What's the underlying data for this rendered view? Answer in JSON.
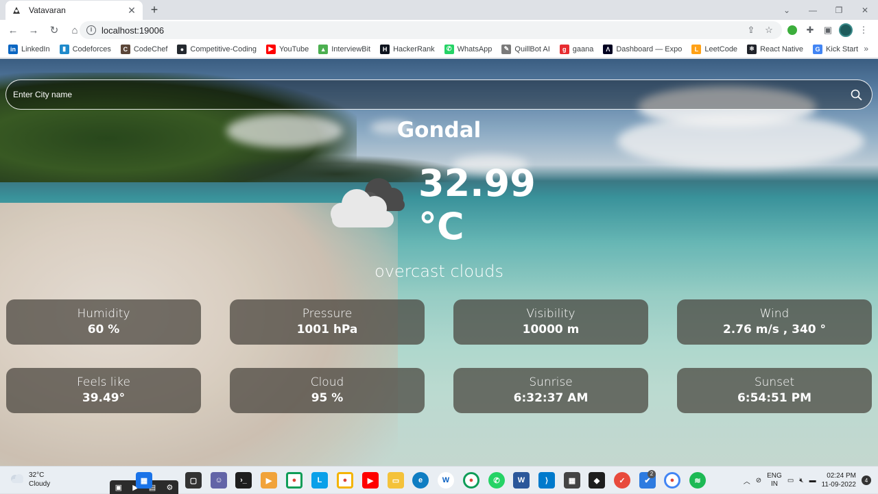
{
  "browser": {
    "tab_title": "Vatavaran",
    "url": "localhost:19006",
    "bookmarks": [
      {
        "label": "LinkedIn",
        "color": "#0a66c2",
        "glyph": "in"
      },
      {
        "label": "Codeforces",
        "color": "#1f8acb",
        "glyph": "▮"
      },
      {
        "label": "CodeChef",
        "color": "#5b4638",
        "glyph": "C"
      },
      {
        "label": "Competitive-Coding",
        "color": "#24292f",
        "glyph": "●"
      },
      {
        "label": "YouTube",
        "color": "#ff0000",
        "glyph": "▶"
      },
      {
        "label": "InterviewBit",
        "color": "#4caf50",
        "glyph": "▲"
      },
      {
        "label": "HackerRank",
        "color": "#0e141e",
        "glyph": "H"
      },
      {
        "label": "WhatsApp",
        "color": "#25d366",
        "glyph": "✆"
      },
      {
        "label": "QuillBot AI",
        "color": "#7a7a7a",
        "glyph": "✎"
      },
      {
        "label": "gaana",
        "color": "#e72c30",
        "glyph": "g"
      },
      {
        "label": "Dashboard — Expo",
        "color": "#000020",
        "glyph": "Λ"
      },
      {
        "label": "LeetCode",
        "color": "#ffa116",
        "glyph": "L"
      },
      {
        "label": "React Native",
        "color": "#20232a",
        "glyph": "⚛"
      },
      {
        "label": "Kick Start",
        "color": "#4285f4",
        "glyph": "G"
      }
    ],
    "more": "»"
  },
  "app": {
    "search_placeholder": "Enter City name",
    "city": "Gondal",
    "temperature": "32.99 °C",
    "description": "overcast clouds",
    "cards": [
      {
        "label": "Humidity",
        "value": "60 %"
      },
      {
        "label": "Pressure",
        "value": "1001 hPa"
      },
      {
        "label": "Visibility",
        "value": "10000 m"
      },
      {
        "label": "Wind",
        "value": "2.76 m/s , 340 °"
      },
      {
        "label": "Feels like",
        "value": "39.49°"
      },
      {
        "label": "Cloud",
        "value": "95 %"
      },
      {
        "label": "Sunrise",
        "value": "6:32:37 AM"
      },
      {
        "label": "Sunset",
        "value": "6:54:51 PM"
      }
    ]
  },
  "taskbar": {
    "weather_temp": "32°C",
    "weather_desc": "Cloudy",
    "lang_top": "ENG",
    "lang_bottom": "IN",
    "time": "02:24 PM",
    "date": "11-09-2022",
    "notification_count": "4",
    "badge_count": "2"
  }
}
